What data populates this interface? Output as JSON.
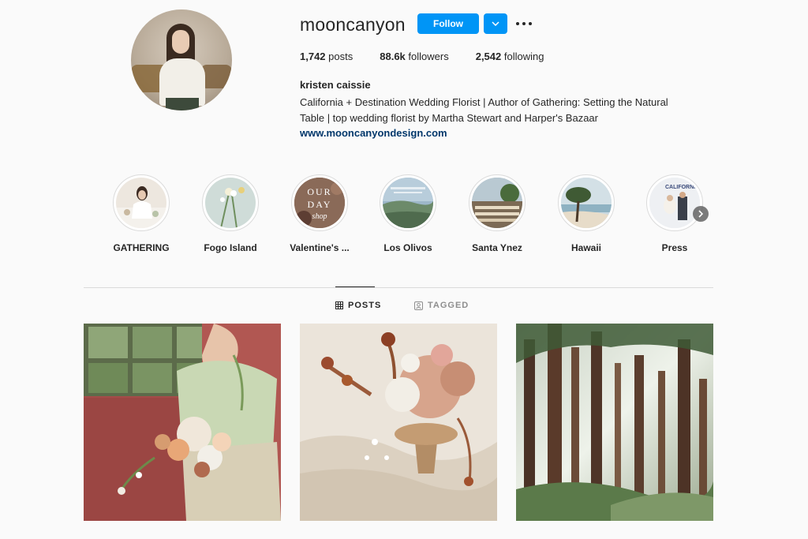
{
  "profile": {
    "username": "mooncanyon",
    "follow_label": "Follow",
    "stats": {
      "posts_count": "1,742",
      "posts_label": "posts",
      "followers_count": "88.6k",
      "followers_label": "followers",
      "following_count": "2,542",
      "following_label": "following"
    },
    "full_name": "kristen caissie",
    "bio_line1": "California + Destination Wedding Florist | Author of Gathering: Setting the Natural",
    "bio_line2": "Table | top wedding florist by Martha Stewart and Harper's Bazaar",
    "website": "www.mooncanyondesign.com"
  },
  "highlights": [
    {
      "label": "GATHERING"
    },
    {
      "label": "Fogo Island"
    },
    {
      "label": "Valentine's ..."
    },
    {
      "label": "Los Olivos"
    },
    {
      "label": "Santa Ynez"
    },
    {
      "label": "Hawaii"
    },
    {
      "label": "Press"
    }
  ],
  "highlight_image_text": {
    "valentines": [
      "OUR",
      "DAY",
      "shop"
    ],
    "press": "CALIFORNIA"
  },
  "tabs": {
    "posts": "POSTS",
    "tagged": "TAGGED"
  },
  "colors": {
    "accent": "#0095f6",
    "link": "#00376b",
    "background": "#fafafa"
  },
  "icons": {
    "dropdown": "chevron-down-icon",
    "more": "more-options-icon",
    "posts_tab": "grid-icon",
    "tagged_tab": "tag-icon",
    "next": "chevron-right-icon"
  }
}
